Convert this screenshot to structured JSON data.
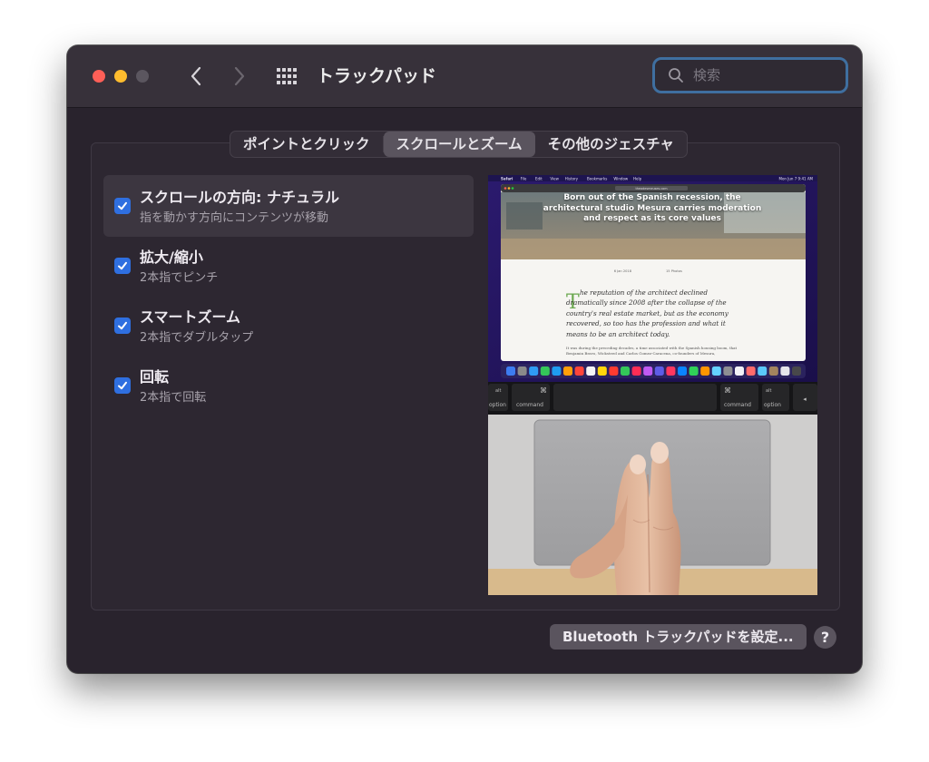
{
  "window": {
    "title": "トラックパッド",
    "search_placeholder": "検索"
  },
  "tabs": [
    {
      "label": "ポイントとクリック",
      "active": false
    },
    {
      "label": "スクロールとズーム",
      "active": true
    },
    {
      "label": "その他のジェスチャ",
      "active": false
    }
  ],
  "options": [
    {
      "title": "スクロールの方向: ナチュラル",
      "subtitle": "指を動かす方向にコンテンツが移動",
      "checked": true,
      "selected": true
    },
    {
      "title": "拡大/縮小",
      "subtitle": "2本指でピンチ",
      "checked": true,
      "selected": false
    },
    {
      "title": "スマートズーム",
      "subtitle": "2本指でダブルタップ",
      "checked": true,
      "selected": false
    },
    {
      "title": "回転",
      "subtitle": "2本指で回転",
      "checked": true,
      "selected": false
    }
  ],
  "preview": {
    "menubar": [
      "Safari",
      "File",
      "Edit",
      "View",
      "History",
      "Bookmarks",
      "Window",
      "Help"
    ],
    "menubar_time": "Mon Jun 7  9:41 AM",
    "url": "theadesmeuses.com",
    "hero_headline": "Born out of the Spanish recession, the architectural studio Mesura carries moderation and respect as its core values",
    "meta_date": "6 Jan 2018",
    "meta_photos": "15 Photos",
    "drop_cap": "T",
    "article_lead": "he reputation of the architect declined dramatically since 2008 after the collapse of the country's real estate market, but as the economy recovered, so too has the profession and what it means to be an architect today.",
    "article_small": "It was during the preceding decades, a time associated with the Spanish housing boom, that Benjamin Bravo, Wicksteed and Carlos Gomez-Caracena, co-founders of Mesura,",
    "keys": {
      "alt_left": "alt",
      "option_left": "option",
      "cmd_symbol": "⌘",
      "command_left": "command",
      "command_right": "command",
      "alt_right": "alt",
      "option_right": "option",
      "arrow": "◂"
    }
  },
  "footer": {
    "bluetooth_button": "Bluetooth トラックパッドを設定...",
    "help": "?"
  },
  "colors": {
    "window_bg": "#29232d",
    "accent_checkbox": "#2f6fe0",
    "search_focus": "#3f6fa0"
  }
}
